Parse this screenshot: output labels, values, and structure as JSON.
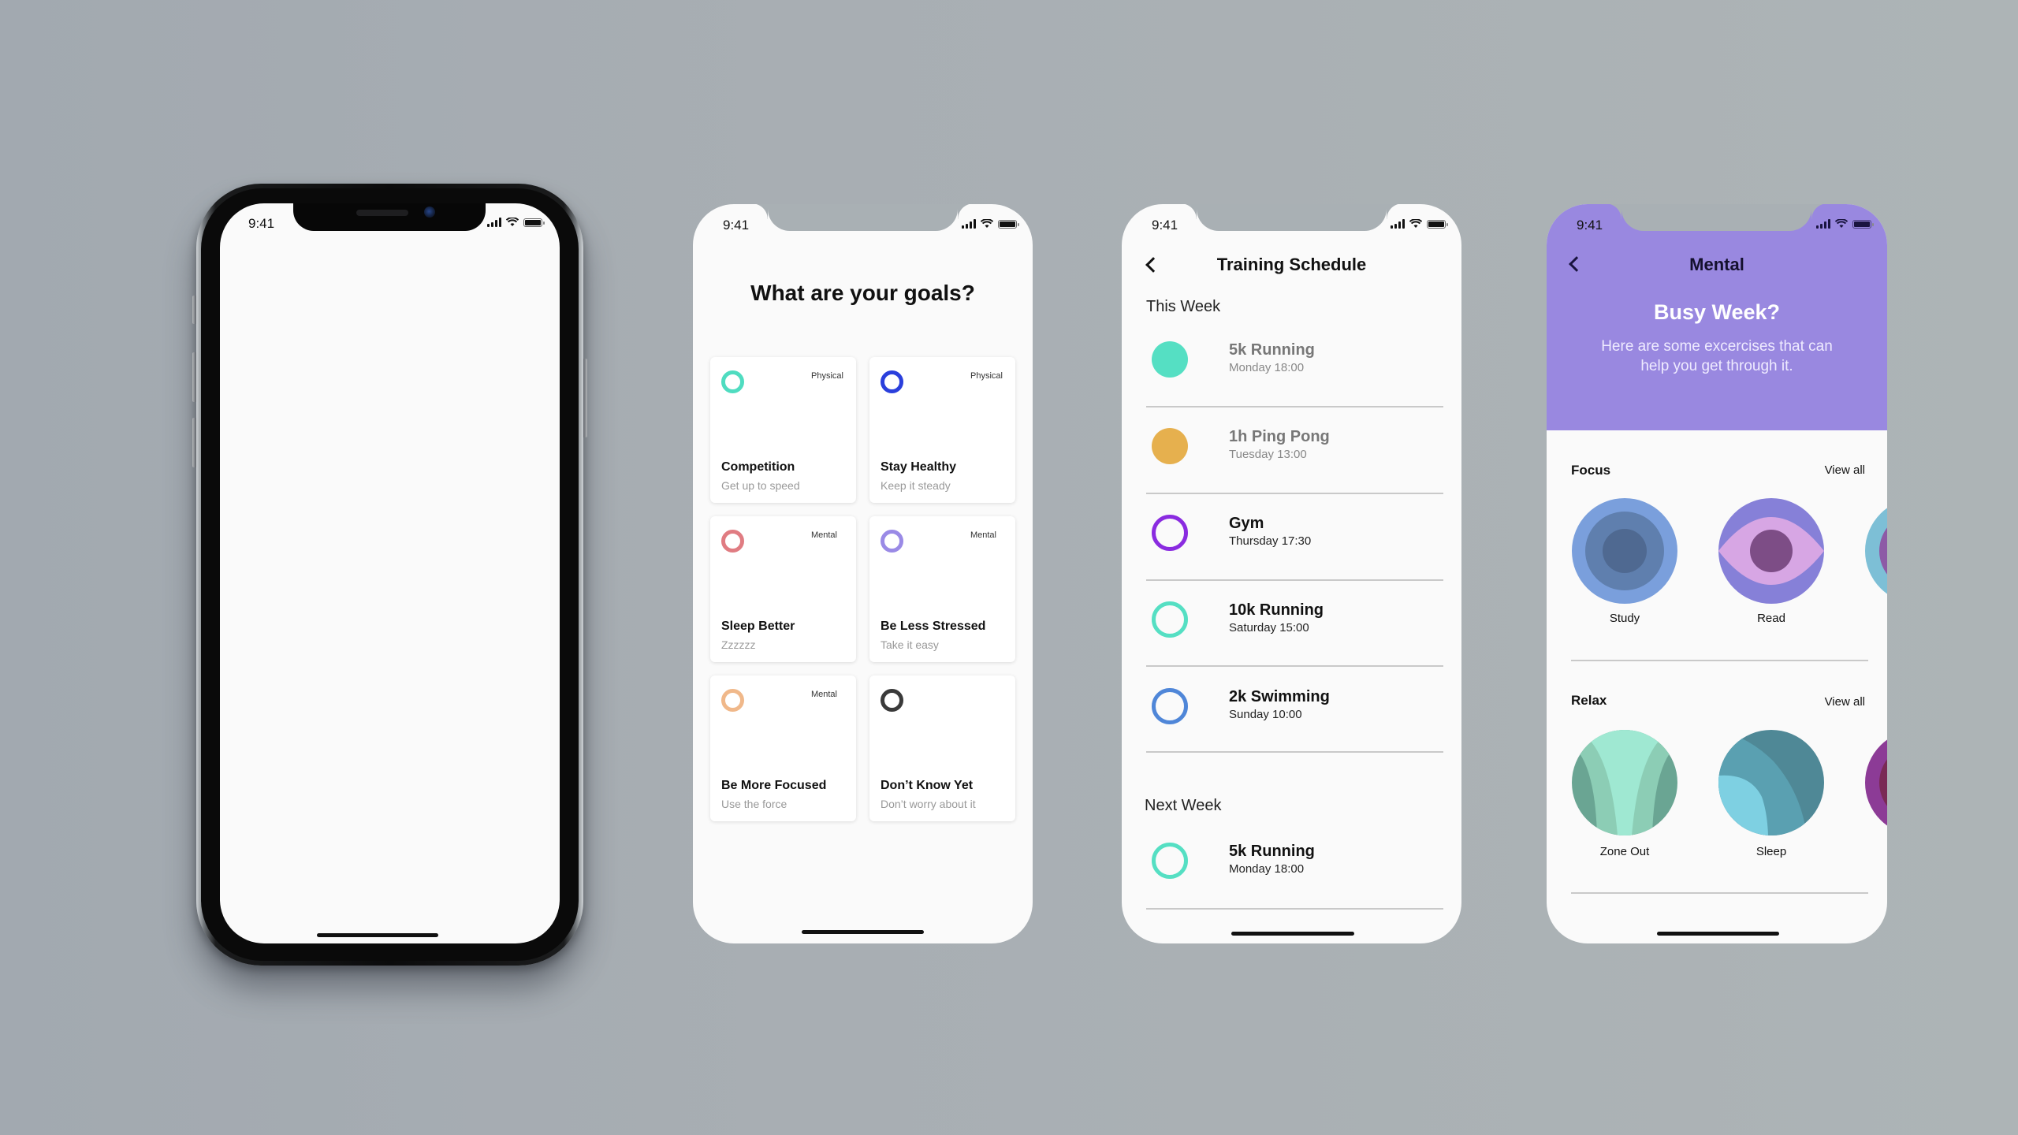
{
  "status_bar": {
    "time": "9:41"
  },
  "device_mockup": {
    "screen": "blank"
  },
  "goals_screen": {
    "title": "What are your goals?",
    "cards": [
      {
        "title": "Competition",
        "subtitle": "Get up to speed",
        "tag": "Physical",
        "ring_color": "#4fdcc0"
      },
      {
        "title": "Stay Healthy",
        "subtitle": "Keep it steady",
        "tag": "Physical",
        "ring_color": "#2a3fdc"
      },
      {
        "title": "Sleep Better",
        "subtitle": "Zzzzzz",
        "tag": "Mental",
        "ring_color": "#e07c82"
      },
      {
        "title": "Be Less Stressed",
        "subtitle": "Take it easy",
        "tag": "Mental",
        "ring_color": "#9a8ae6"
      },
      {
        "title": "Be More Focused",
        "subtitle": "Use the force",
        "tag": "Mental",
        "ring_color": "#f0b88a"
      },
      {
        "title": "Don’t Know Yet",
        "subtitle": "Don’t worry about it",
        "tag": "",
        "ring_color": "#3a3a3a"
      }
    ]
  },
  "schedule_screen": {
    "title": "Training Schedule",
    "this_week_label": "This Week",
    "next_week_label": "Next Week",
    "this_week": [
      {
        "name": "5k Running",
        "time": "Monday 18:00",
        "color": "#55dfc3",
        "completed": true
      },
      {
        "name": "1h Ping Pong",
        "time": "Tuesday 13:00",
        "color": "#e6b04e",
        "completed": true
      },
      {
        "name": "Gym",
        "time": "Thursday 17:30",
        "color": "#8a2be0",
        "completed": false
      },
      {
        "name": "10k Running",
        "time": "Saturday 15:00",
        "color": "#55dfc3",
        "completed": false
      },
      {
        "name": "2k Swimming",
        "time": "Sunday 10:00",
        "color": "#4f86d8",
        "completed": false
      }
    ],
    "next_week": [
      {
        "name": "5k Running",
        "time": "Monday 18:00",
        "color": "#55dfc3",
        "completed": false
      }
    ]
  },
  "mental_screen": {
    "title": "Mental",
    "header_color": "#9988e0",
    "hero_title": "Busy Week?",
    "hero_text": "Here are some excercises that can help you get through it.",
    "categories": [
      {
        "title": "Focus",
        "view_all": "View all",
        "items": [
          {
            "label": "Study"
          },
          {
            "label": "Read"
          }
        ]
      },
      {
        "title": "Relax",
        "view_all": "View all",
        "items": [
          {
            "label": "Zone Out"
          },
          {
            "label": "Sleep"
          }
        ]
      }
    ]
  }
}
